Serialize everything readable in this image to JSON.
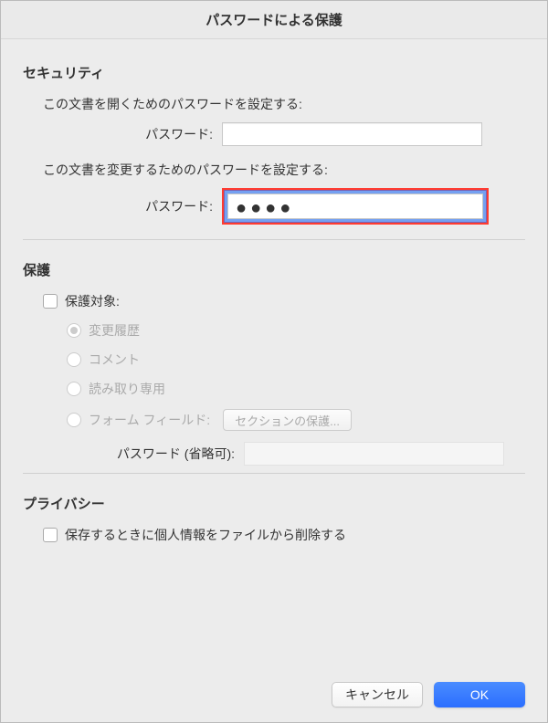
{
  "window": {
    "title": "パスワードによる保護"
  },
  "security": {
    "heading": "セキュリティ",
    "open_desc": "この文書を開くためのパスワードを設定する:",
    "open_label": "パスワード:",
    "open_value": "",
    "modify_desc": "この文書を変更するためのパスワードを設定する:",
    "modify_label": "パスワード:",
    "modify_dots": "●●●●"
  },
  "protection": {
    "heading": "保護",
    "target_label": "保護対象:",
    "radios": {
      "changes": "変更履歴",
      "comments": "コメント",
      "readonly": "読み取り専用",
      "formfields": "フォーム フィールド:"
    },
    "sections_btn": "セクションの保護...",
    "optional_label": "パスワード (省略可):"
  },
  "privacy": {
    "heading": "プライバシー",
    "remove_personal": "保存するときに個人情報をファイルから削除する"
  },
  "buttons": {
    "cancel": "キャンセル",
    "ok": "OK"
  }
}
